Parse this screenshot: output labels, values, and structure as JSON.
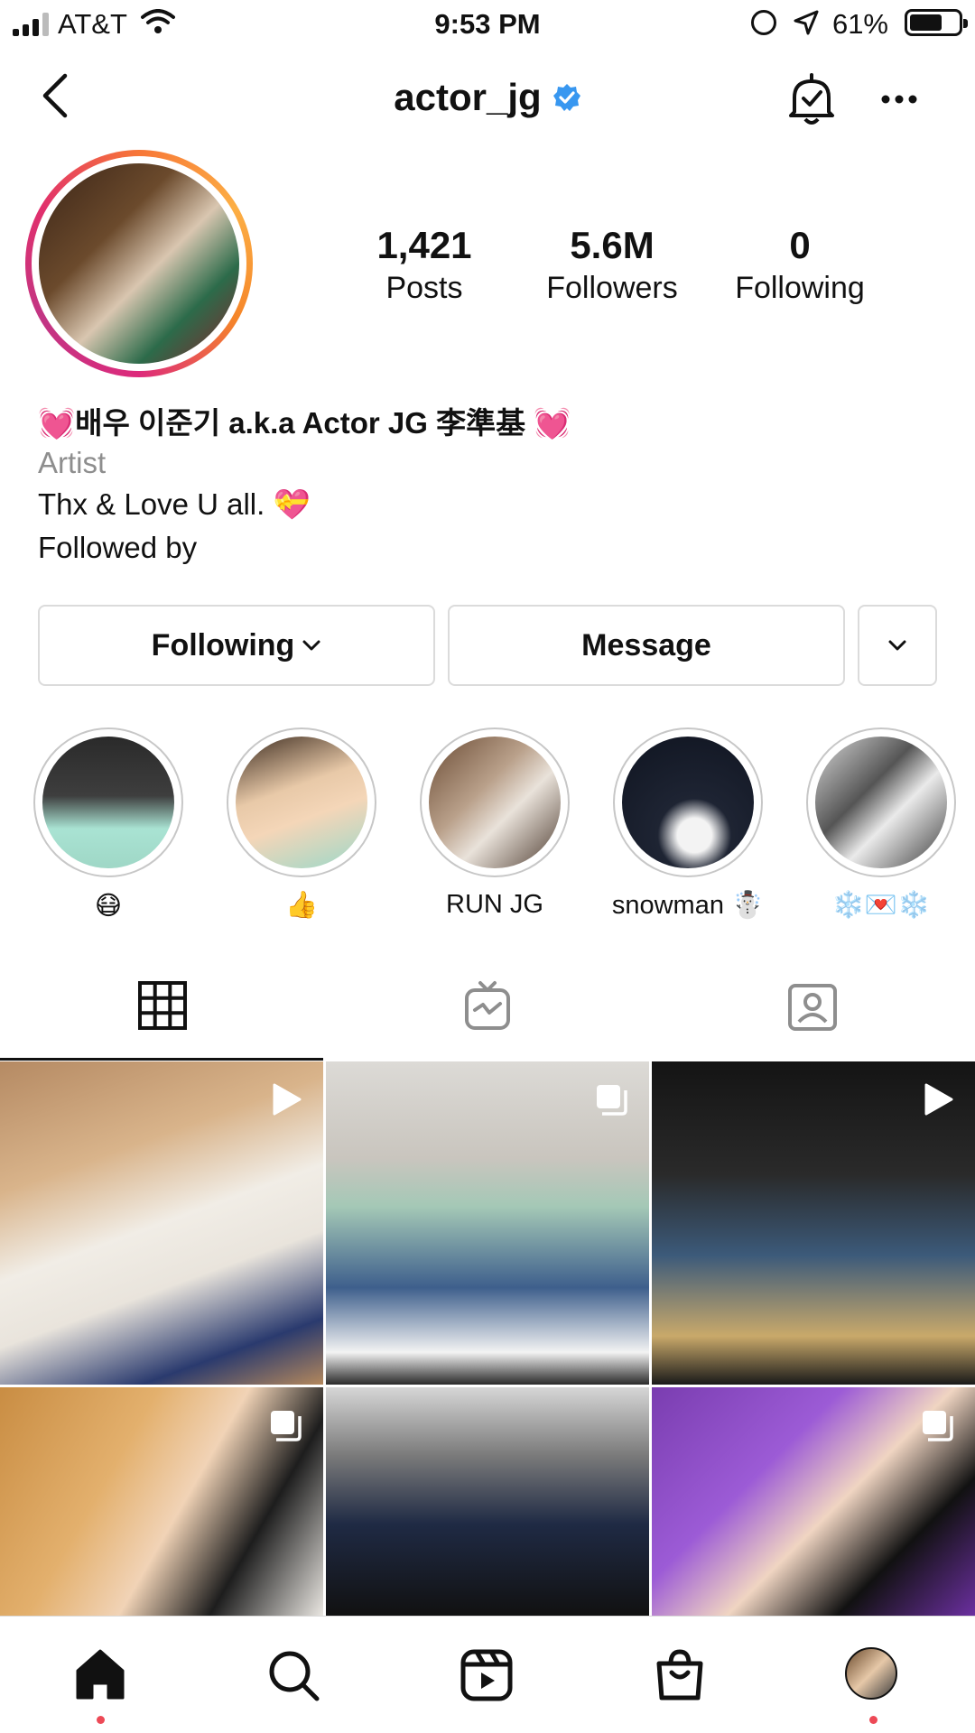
{
  "status_bar": {
    "carrier": "AT&T",
    "time": "9:53 PM",
    "battery": "61%"
  },
  "header": {
    "username": "actor_jg",
    "verified": true
  },
  "stats": {
    "posts": {
      "value": "1,421",
      "label": "Posts"
    },
    "followers": {
      "value": "5.6M",
      "label": "Followers"
    },
    "following": {
      "value": "0",
      "label": "Following"
    }
  },
  "bio": {
    "name": "💓배우 이준기 a.k.a Actor JG 李準基 💓",
    "category": "Artist",
    "text": "Thx & Love U all. 💝",
    "followed_by": "Followed by"
  },
  "buttons": {
    "following": "Following",
    "message": "Message"
  },
  "highlights": [
    {
      "label": "😷"
    },
    {
      "label": "👍"
    },
    {
      "label": "RUN JG"
    },
    {
      "label": "snowman ☃️"
    },
    {
      "label": "❄️💌❄️"
    }
  ],
  "tabs": [
    "grid-icon",
    "igtv-icon",
    "tagged-icon"
  ],
  "grid": [
    {
      "type": "video"
    },
    {
      "type": "carousel"
    },
    {
      "type": "video"
    },
    {
      "type": "carousel"
    },
    {
      "type": "photo"
    },
    {
      "type": "carousel"
    }
  ],
  "bottom_nav": [
    "home-icon",
    "search-icon",
    "reels-icon",
    "shop-icon",
    "profile-avatar"
  ],
  "colors": {
    "accent": "#3897f0",
    "notification": "#ed4956",
    "border": "#dbdbdb",
    "muted": "#8e8e8e"
  }
}
